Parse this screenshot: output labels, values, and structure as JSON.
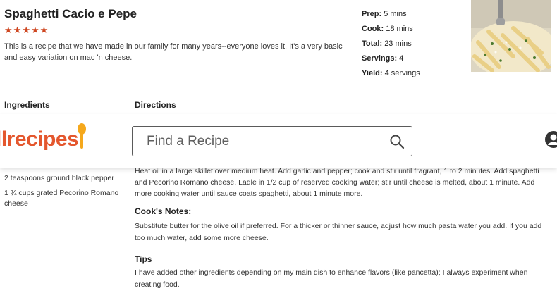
{
  "recipe": {
    "title": "Spaghetti Cacio e Pepe",
    "rating": 5,
    "star_glyph": "★",
    "description": "This is a recipe that we have made in our family for many years--everyone loves it. It's a very basic and easy variation on mac 'n cheese.",
    "meta": [
      {
        "label": "Prep:",
        "value": "5 mins"
      },
      {
        "label": "Cook:",
        "value": "18 mins"
      },
      {
        "label": "Total:",
        "value": "23 mins"
      },
      {
        "label": "Servings:",
        "value": "4"
      },
      {
        "label": "Yield:",
        "value": "4 servings"
      }
    ]
  },
  "sections": {
    "ingredients_heading": "Ingredients",
    "directions_heading": "Directions"
  },
  "ingredients": [
    "2 teaspoons ground black pepper",
    "1 ¾ cups grated Pecorino Romano cheese"
  ],
  "directions_text": "Heat oil in a large skillet over medium heat. Add garlic and pepper; cook and stir until fragrant, 1 to 2 minutes. Add spaghetti and Pecorino Romano cheese. Ladle in 1/2 cup of reserved cooking water; stir until cheese is melted, about 1 minute. Add more cooking water until sauce coats spaghetti, about 1 minute more.",
  "cooks_notes": {
    "title": "Cook's Notes:",
    "body": "Substitute butter for the olive oil if preferred. For a thicker or thinner sauce, adjust how much pasta water you add. If you add too much water, add some more cheese."
  },
  "tips": {
    "title": "Tips",
    "body": "I have added other ingredients depending on my main dish to enhance flavors (like pancetta); I always experiment when creating food."
  },
  "header": {
    "logo_text": "llrecipes",
    "search_placeholder": "Find a Recipe",
    "search_icon": "search-icon",
    "user_icon": "user-icon"
  },
  "colors": {
    "brand": "#e4572e",
    "star": "#ce4620",
    "text": "#222222"
  }
}
